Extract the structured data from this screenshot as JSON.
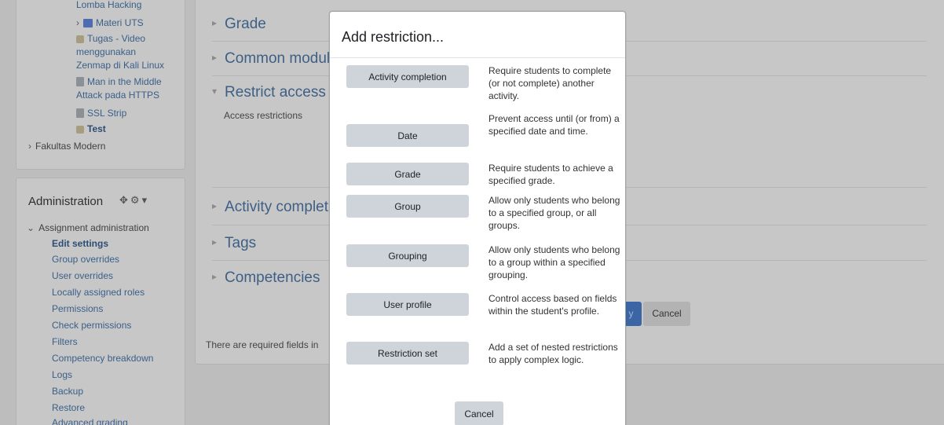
{
  "nav": {
    "items": [
      {
        "label": "Lomba Hacking"
      },
      {
        "label": "Materi UTS"
      },
      {
        "label": "Tugas - Video",
        "line2": "menggunakan",
        "line3": "Zenmap di Kali Linux"
      },
      {
        "label": "Man in the Middle",
        "line2": "Attack pada HTTPS"
      },
      {
        "label": "SSL Strip"
      },
      {
        "label": "Test"
      },
      {
        "label": "Fakultas Modern"
      }
    ]
  },
  "admin": {
    "title": "Administration",
    "group": "Assignment administration",
    "items": [
      {
        "label": "Edit settings"
      },
      {
        "label": "Group overrides"
      },
      {
        "label": "User overrides"
      },
      {
        "label": "Locally assigned roles"
      },
      {
        "label": "Permissions"
      },
      {
        "label": "Check permissions"
      },
      {
        "label": "Filters"
      },
      {
        "label": "Competency breakdown"
      },
      {
        "label": "Logs"
      },
      {
        "label": "Backup"
      },
      {
        "label": "Restore"
      },
      {
        "label": "Advanced grading"
      }
    ]
  },
  "main": {
    "sections": [
      {
        "label": "Grade"
      },
      {
        "label": "Common modul"
      },
      {
        "label": "Restrict access"
      },
      {
        "label": "Activity complet"
      },
      {
        "label": "Tags"
      },
      {
        "label": "Competencies"
      }
    ],
    "access_restrictions_label": "Access restrictions",
    "required_fields_note": "There are required fields in",
    "save_button_label": "y",
    "cancel_button_label": "Cancel"
  },
  "modal": {
    "title": "Add restriction...",
    "options": [
      {
        "button": "Activity completion",
        "description": "Require students to complete (or not complete) another activity."
      },
      {
        "button": "Date",
        "description": "Prevent access until (or from) a specified date and time."
      },
      {
        "button": "Grade",
        "description": "Require students to achieve a specified grade."
      },
      {
        "button": "Group",
        "description": "Allow only students who belong to a specified group, or all groups."
      },
      {
        "button": "Grouping",
        "description": "Allow only students who belong to a group within a specified grouping."
      },
      {
        "button": "User profile",
        "description": "Control access based on fields within the student's profile."
      },
      {
        "button": "Restriction set",
        "description": "Add a set of nested restrictions to apply complex logic."
      }
    ],
    "cancel_label": "Cancel"
  },
  "icons": {
    "folder": "folder-icon",
    "assignment": "assignment-icon",
    "page": "page-icon",
    "chevron": "chevron-right-icon",
    "settings": "gear-icon",
    "move": "move-icon"
  },
  "colors": {
    "backdrop": "#bdbdbd",
    "link": "#3a5f88",
    "primary": "#3c65a6",
    "secondary_button": "#ced4da",
    "modal_bg": "#ffffff"
  }
}
